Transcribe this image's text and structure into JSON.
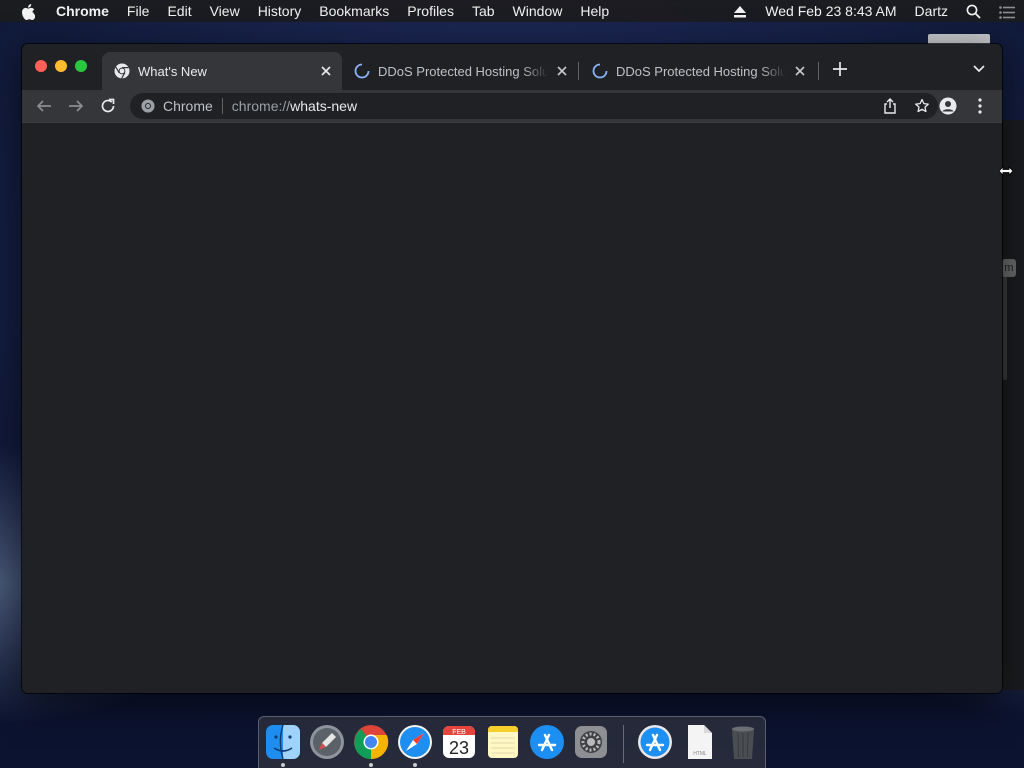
{
  "menubar": {
    "app_name": "Chrome",
    "items": [
      "File",
      "Edit",
      "View",
      "History",
      "Bookmarks",
      "Profiles",
      "Tab",
      "Window",
      "Help"
    ],
    "datetime": "Wed Feb 23  8:43 AM",
    "user": "Dartz"
  },
  "tabs": [
    {
      "title": "What's New",
      "active": true,
      "favicon": "chrome-icon"
    },
    {
      "title": "DDoS Protected Hosting Solutions",
      "active": false,
      "favicon": "loading-spinner-icon"
    },
    {
      "title": "DDoS Protected Hosting Solutions",
      "active": false,
      "favicon": "loading-spinner-icon"
    }
  ],
  "omnibox": {
    "chip_label": "Chrome",
    "url_scheme": "chrome://",
    "url_host": "whats-new"
  },
  "background_window": {
    "tag_text": "m"
  },
  "dock": {
    "apps": [
      "finder-icon",
      "launchpad-icon",
      "chrome-icon",
      "safari-icon",
      "calendar-icon",
      "notes-icon",
      "app-store-icon",
      "system-preferences-icon",
      "app-store-download-icon",
      "html-file-icon",
      "trash-icon"
    ],
    "calendar": {
      "month": "FEB",
      "day": "23"
    },
    "file_label": "HTML"
  },
  "colors": {
    "window_bg": "#202124",
    "toolbar_bg": "#35363a",
    "accent_blue": "#8ab4f8"
  }
}
